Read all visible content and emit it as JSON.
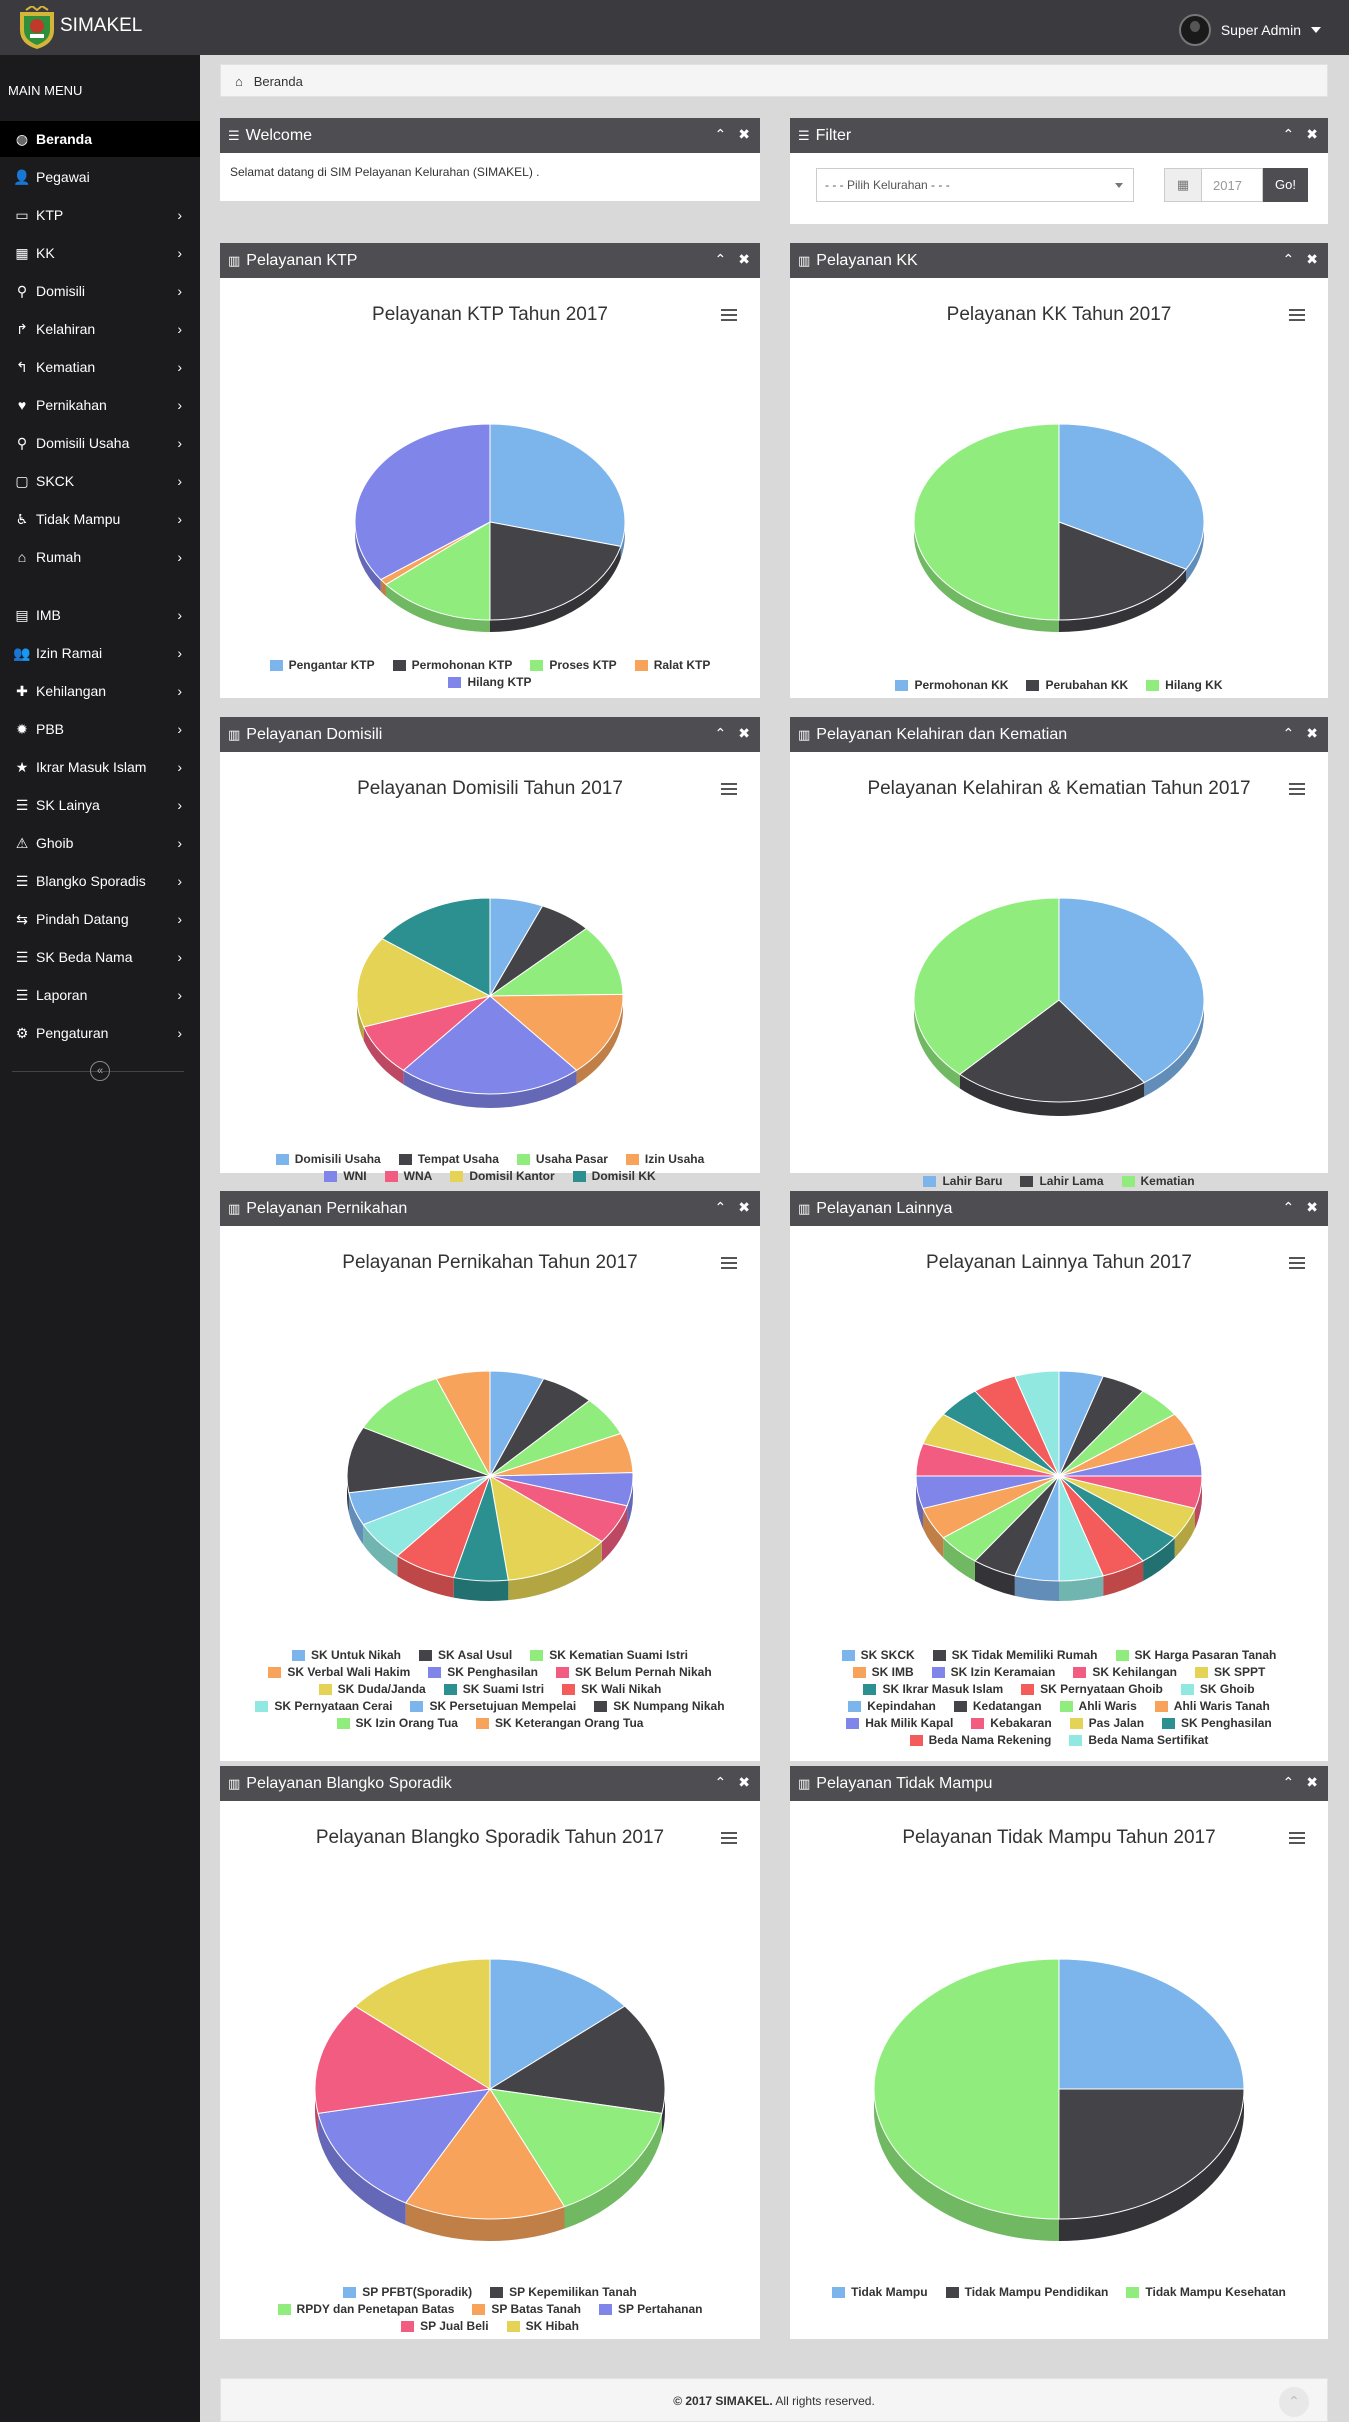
{
  "app": {
    "brand": "SIMAKEL",
    "user": "Super Admin"
  },
  "sidebar": {
    "heading": "MAIN MENU",
    "items": [
      {
        "label": "Beranda",
        "icon": "dashboard-icon",
        "glyph": "◍",
        "chevron": false,
        "active": true
      },
      {
        "label": "Pegawai",
        "icon": "user-icon",
        "glyph": "👤",
        "chevron": false
      },
      {
        "label": "KTP",
        "icon": "id-card-icon",
        "glyph": "▭",
        "chevron": true
      },
      {
        "label": "KK",
        "icon": "grid-icon",
        "glyph": "▦",
        "chevron": true
      },
      {
        "label": "Domisili",
        "icon": "map-marker-icon",
        "glyph": "⚲",
        "chevron": true
      },
      {
        "label": "Kelahiran",
        "icon": "share-icon",
        "glyph": "↱",
        "chevron": true
      },
      {
        "label": "Kematian",
        "icon": "reply-icon",
        "glyph": "↰",
        "chevron": true
      },
      {
        "label": "Pernikahan",
        "icon": "heart-icon",
        "glyph": "♥",
        "chevron": true
      },
      {
        "label": "Domisili Usaha",
        "icon": "map-marker-icon",
        "glyph": "⚲",
        "chevron": true
      },
      {
        "label": "SKCK",
        "icon": "folder-icon",
        "glyph": "▢",
        "chevron": true
      },
      {
        "label": "Tidak Mampu",
        "icon": "wheelchair-icon",
        "glyph": "♿",
        "chevron": true
      },
      {
        "label": "Rumah",
        "icon": "home-icon",
        "glyph": "⌂",
        "chevron": true
      },
      {
        "label": "IMB",
        "icon": "building-icon",
        "glyph": "▤",
        "chevron": true
      },
      {
        "label": "Izin Ramai",
        "icon": "users-icon",
        "glyph": "👥",
        "chevron": true
      },
      {
        "label": "Kehilangan",
        "icon": "puzzle-icon",
        "glyph": "✚",
        "chevron": true
      },
      {
        "label": "PBB",
        "icon": "certificate-icon",
        "glyph": "✹",
        "chevron": true
      },
      {
        "label": "Ikrar Masuk Islam",
        "icon": "star-icon",
        "glyph": "★",
        "chevron": true
      },
      {
        "label": "SK Lainya",
        "icon": "list-icon",
        "glyph": "☰",
        "chevron": true
      },
      {
        "label": "Ghoib",
        "icon": "warning-icon",
        "glyph": "⚠",
        "chevron": true
      },
      {
        "label": "Blangko Sporadis",
        "icon": "list-icon",
        "glyph": "☰",
        "chevron": true
      },
      {
        "label": "Pindah Datang",
        "icon": "exchange-icon",
        "glyph": "⇆",
        "chevron": true
      },
      {
        "label": "SK Beda Nama",
        "icon": "list-icon",
        "glyph": "☰",
        "chevron": true
      },
      {
        "label": "Laporan",
        "icon": "list-icon",
        "glyph": "☰",
        "chevron": true
      },
      {
        "label": "Pengaturan",
        "icon": "gear-icon",
        "glyph": "⚙",
        "chevron": true
      }
    ]
  },
  "breadcrumb": {
    "label": "Beranda"
  },
  "welcome": {
    "title": "Welcome",
    "text": "Selamat datang di SIM Pelayanan Kelurahan (SIMAKEL) ."
  },
  "filter": {
    "title": "Filter",
    "select_value": "- - - Pilih Kelurahan - - -",
    "year": "2017",
    "go": "Go!"
  },
  "colors": {
    "c1": "#7cb5ec",
    "c2": "#434348",
    "c3": "#90ed7d",
    "c4": "#f7a35c",
    "c5": "#8085e9",
    "c6": "#f15c80",
    "c7": "#e4d354",
    "c8": "#2b908f",
    "c9": "#f45b5b",
    "c10": "#91e8e1"
  },
  "chart_data": [
    {
      "type": "pie",
      "panel": "Pelayanan KTP",
      "title": "Pelayanan KTP Tahun 2017",
      "categories": [
        "Pengantar KTP",
        "Permohonan KTP",
        "Proses KTP",
        "Ralat KTP",
        "Hilang KTP"
      ],
      "values": [
        29,
        21,
        14,
        1,
        35
      ]
    },
    {
      "type": "pie",
      "panel": "Pelayanan KK",
      "title": "Pelayanan KK Tahun 2017",
      "categories": [
        "Permohonan KK",
        "Perubahan KK",
        "Hilang KK"
      ],
      "values": [
        33,
        17,
        50
      ]
    },
    {
      "type": "pie",
      "panel": "Pelayanan Domisili",
      "title": "Pelayanan Domisili Tahun 2017",
      "categories": [
        "Domisili Usaha",
        "Tempat Usaha",
        "Usaha Pasar",
        "Izin Usaha",
        "WNI",
        "WNA",
        "Domisil Kantor",
        "Domisil KK"
      ],
      "values": [
        6,
        6,
        11,
        13,
        21,
        8,
        14,
        14
      ]
    },
    {
      "type": "pie",
      "panel": "Pelayanan Kelahiran dan Kematian",
      "title": "Pelayanan Kelahiran & Kematian Tahun 2017",
      "categories": [
        "Lahir Baru",
        "Lahir Lama",
        "Kematian"
      ],
      "values": [
        40,
        22,
        38
      ]
    },
    {
      "type": "pie",
      "panel": "Pelayanan Pernikahan",
      "title": "Pelayanan Pernikahan Tahun 2017",
      "categories": [
        "SK Untuk Nikah",
        "SK Asal Usul",
        "SK Kematian Suami Istri",
        "SK Verbal Wali Hakim",
        "SK Penghasilan",
        "SK Belum Pernah Nikah",
        "SK Duda/Janda",
        "SK Suami Istri",
        "SK Wali Nikah",
        "SK Pernyataan Cerai",
        "SK Persetujuan Mempelai",
        "SK Numpang Nikah",
        "SK Izin Orang Tua",
        "SK Keterangan Orang Tua"
      ],
      "values": [
        6,
        6,
        6,
        6,
        5,
        6,
        12,
        6,
        7,
        6,
        5,
        10,
        11,
        6
      ]
    },
    {
      "type": "pie",
      "panel": "Pelayanan Lainnya",
      "title": "Pelayanan Lainnya Tahun 2017",
      "categories": [
        "SK SKCK",
        "SK Tidak Memiliki Rumah",
        "SK Harga Pasaran Tanah",
        "SK IMB",
        "SK Izin Keramaian",
        "SK Kehilangan",
        "SK SPPT",
        "SK Ikrar Masuk Islam",
        "SK Pernyataan Ghoib",
        "SK Ghoib",
        "Kepindahan",
        "Kedatangan",
        "Ahli Waris",
        "Ahli Waris Tanah",
        "Hak Milik Kapal",
        "Kebakaran",
        "Pas Jalan",
        "SK Penghasilan",
        "Beda Nama Rekening",
        "Beda Nama Sertifikat"
      ],
      "values": [
        5,
        5,
        5,
        5,
        5,
        5,
        5,
        5,
        5,
        5,
        5,
        5,
        5,
        5,
        5,
        5,
        5,
        5,
        5,
        5
      ]
    },
    {
      "type": "pie",
      "panel": "Pelayanan Blangko Sporadik",
      "title": "Pelayanan Blangko Sporadik Tahun 2017",
      "categories": [
        "SP PFBT(Sporadik)",
        "SP Kepemilikan Tanah",
        "RPDY dan Penetapan Batas",
        "SP Batas Tanah",
        "SP Pertahanan",
        "SP Jual Beli",
        "SK Hibah"
      ],
      "values": [
        14,
        14,
        15,
        15,
        14,
        14,
        14
      ]
    },
    {
      "type": "pie",
      "panel": "Pelayanan Tidak Mampu",
      "title": "Pelayanan Tidak Mampu Tahun 2017",
      "categories": [
        "Tidak Mampu",
        "Tidak Mampu Pendidikan",
        "Tidak Mampu Kesehatan"
      ],
      "values": [
        25,
        25,
        50
      ]
    }
  ],
  "footer": {
    "year_brand": "© 2017 SIMAKEL.",
    "rights": " All rights reserved."
  }
}
